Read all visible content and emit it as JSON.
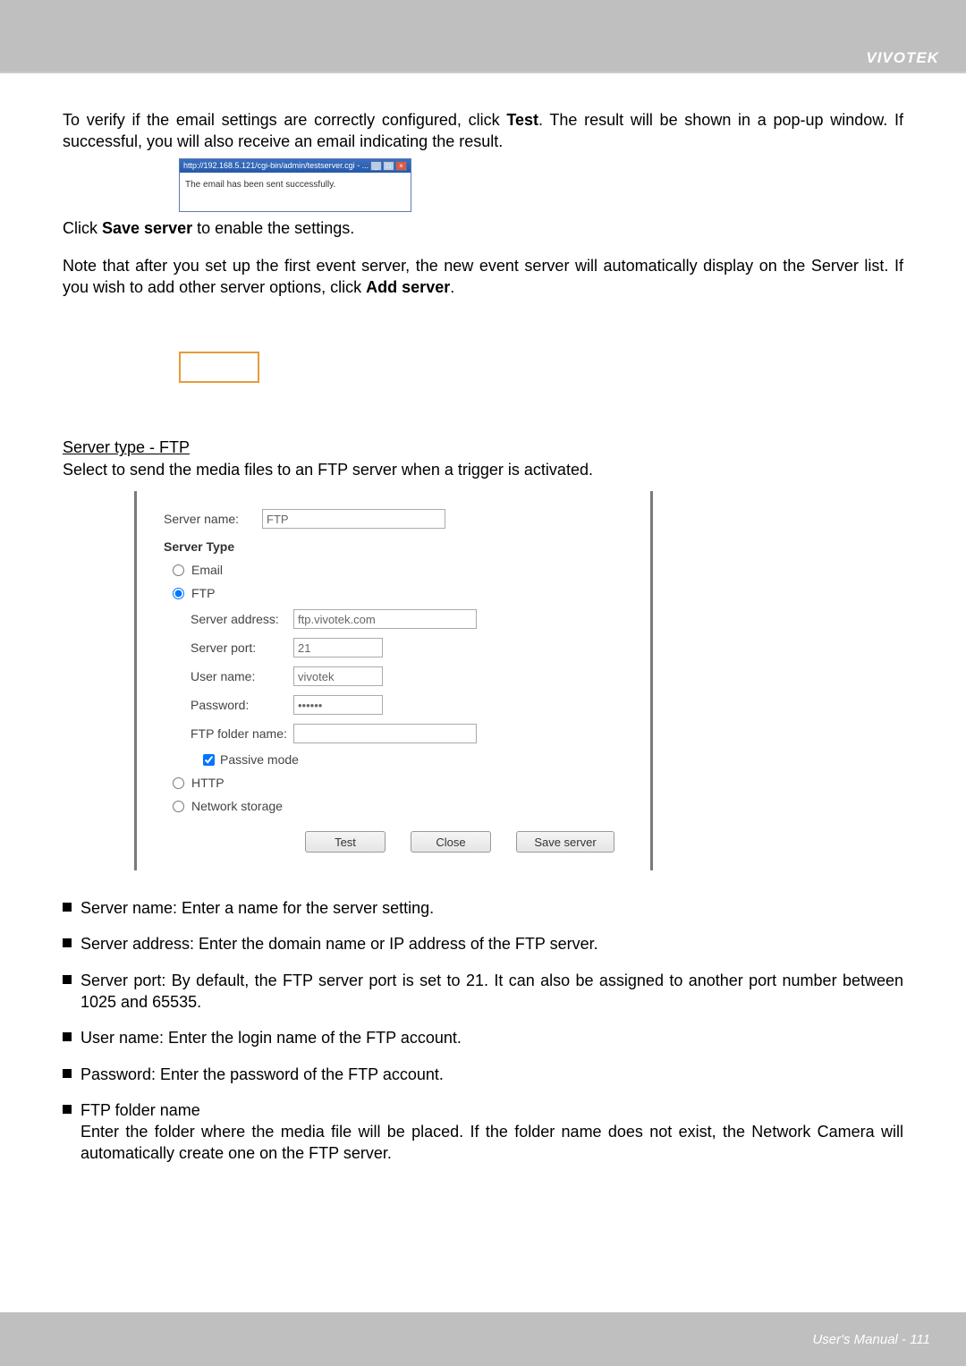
{
  "header": {
    "brand": "VIVOTEK"
  },
  "intro": {
    "line1_a": "To verify if the email settings are correctly configured, click ",
    "line1_b": "Test",
    "line1_c": ". The result will be shown in a pop-up window. If successful, you will also receive an email indicating the result.",
    "popup_title": "http://192.168.5.121/cgi-bin/admin/testserver.cgi - ...",
    "popup_body": "The email has been sent successfully.",
    "click_a": "Click ",
    "click_b": "Save server",
    "click_c": " to enable the settings.",
    "note_a": "Note that after you set up the first event server, the new event server will automatically display on the Server list.  If you wish to add other server options, click ",
    "note_b": "Add server",
    "note_c": "."
  },
  "section": {
    "title": "Server type - FTP",
    "desc": "Select to send the media files to an FTP server when a trigger is activated."
  },
  "form": {
    "server_name_label": "Server name:",
    "server_name_value": "FTP",
    "server_type_heading": "Server Type",
    "opt_email": "Email",
    "opt_ftp": "FTP",
    "server_address_label": "Server address:",
    "server_address_value": "ftp.vivotek.com",
    "server_port_label": "Server port:",
    "server_port_value": "21",
    "user_name_label": "User name:",
    "user_name_value": "vivotek",
    "password_label": "Password:",
    "password_value": "••••••",
    "ftp_folder_label": "FTP folder name:",
    "ftp_folder_value": "",
    "passive_label": "Passive mode",
    "opt_http": "HTTP",
    "opt_ns": "Network storage",
    "btn_test": "Test",
    "btn_close": "Close",
    "btn_save": "Save server"
  },
  "bullets": {
    "b1": "Server name: Enter a name for the server setting.",
    "b2": "Server address: Enter the domain name or IP address of the FTP server.",
    "b3": "Server port: By default, the FTP server port is set to 21. It can also be assigned to another port number between 1025 and 65535.",
    "b4": "User name: Enter the login name of the FTP account.",
    "b5": "Password: Enter the password of the FTP account.",
    "b6_a": "FTP folder name",
    "b6_b": "Enter the folder where the media file will be placed. If the folder name does not exist, the Network Camera will automatically create one on the FTP server."
  },
  "footer": {
    "text": "User's Manual - 111"
  }
}
